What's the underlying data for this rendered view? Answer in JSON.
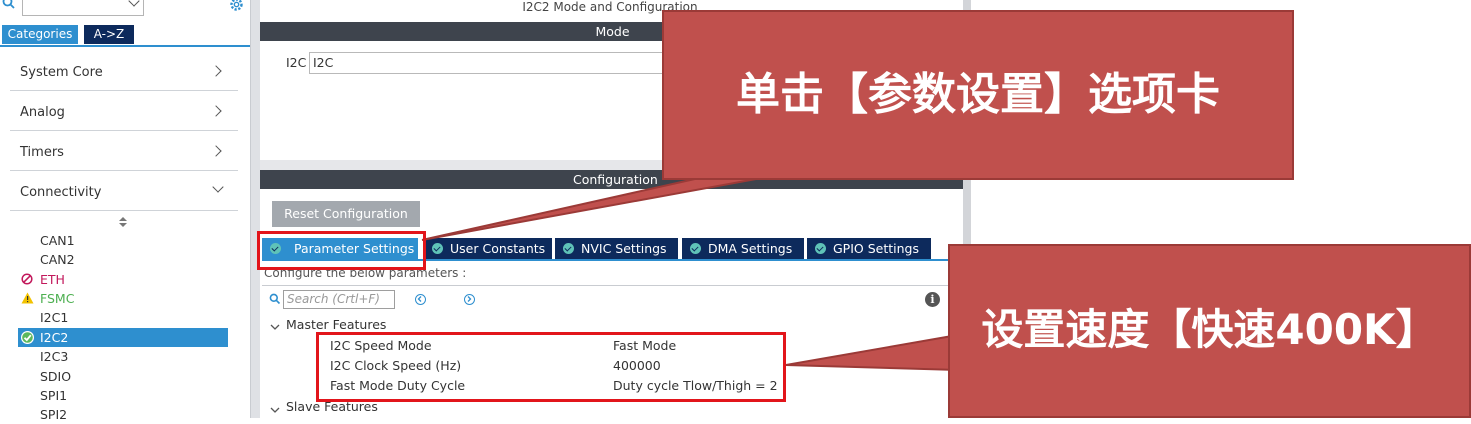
{
  "sidebar": {
    "search_placeholder": "",
    "tabs": [
      "Categories",
      "A->Z"
    ],
    "categories": [
      "System Core",
      "Analog",
      "Timers",
      "Connectivity"
    ],
    "peripherals": [
      {
        "name": "CAN1",
        "status": "none"
      },
      {
        "name": "CAN2",
        "status": "none"
      },
      {
        "name": "ETH",
        "status": "disabled"
      },
      {
        "name": "FSMC",
        "status": "warning"
      },
      {
        "name": "I2C1",
        "status": "none"
      },
      {
        "name": "I2C2",
        "status": "selected"
      },
      {
        "name": "I2C3",
        "status": "none"
      },
      {
        "name": "SDIO",
        "status": "none"
      },
      {
        "name": "SPI1",
        "status": "none"
      },
      {
        "name": "SPI2",
        "status": "none"
      }
    ]
  },
  "main": {
    "title": "I2C2 Mode and Configuration",
    "mode_header": "Mode",
    "i2c_label": "I2C",
    "i2c_value": "I2C",
    "configuration_header": "Configuration",
    "reset_button": "Reset Configuration",
    "tabs": [
      "Parameter Settings",
      "User Constants",
      "NVIC Settings",
      "DMA Settings",
      "GPIO Settings"
    ],
    "configure_text": "Configure the below parameters :",
    "search_placeholder": "Search (Crtl+F)",
    "groups": {
      "master": "Master Features",
      "slave": "Slave Features"
    },
    "params": [
      {
        "name": "I2C Speed Mode",
        "value": "Fast Mode"
      },
      {
        "name": "I2C Clock Speed (Hz)",
        "value": "400000"
      },
      {
        "name": "Fast Mode Duty Cycle",
        "value": "Duty cycle Tlow/Thigh = 2"
      }
    ]
  },
  "annotations": {
    "callout1": "单击【参数设置】选项卡",
    "callout2": "设置速度【快速400K】"
  },
  "colors": {
    "accent": "#2e8fcf",
    "navy": "#0d2a5c",
    "callout": "#c0504d",
    "highlight": "#e2151b"
  }
}
